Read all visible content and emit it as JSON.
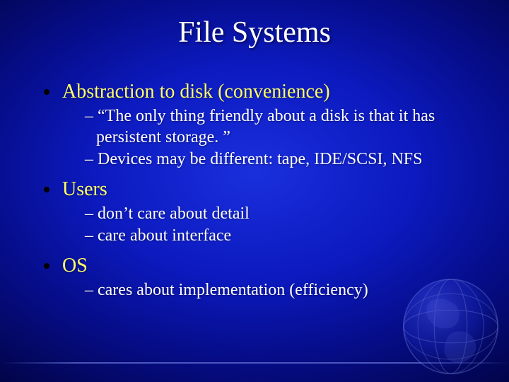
{
  "title": "File Systems",
  "bullets": [
    {
      "text": "Abstraction to disk (convenience)",
      "subs": [
        "– “The only thing friendly about a disk is that it has persistent storage. ”",
        "– Devices may be different: tape, IDE/SCSI, NFS"
      ]
    },
    {
      "text": "Users",
      "subs": [
        "– don’t care about detail",
        "– care about interface"
      ]
    },
    {
      "text": "OS",
      "subs": [
        "– cares about implementation (efficiency)"
      ]
    }
  ]
}
